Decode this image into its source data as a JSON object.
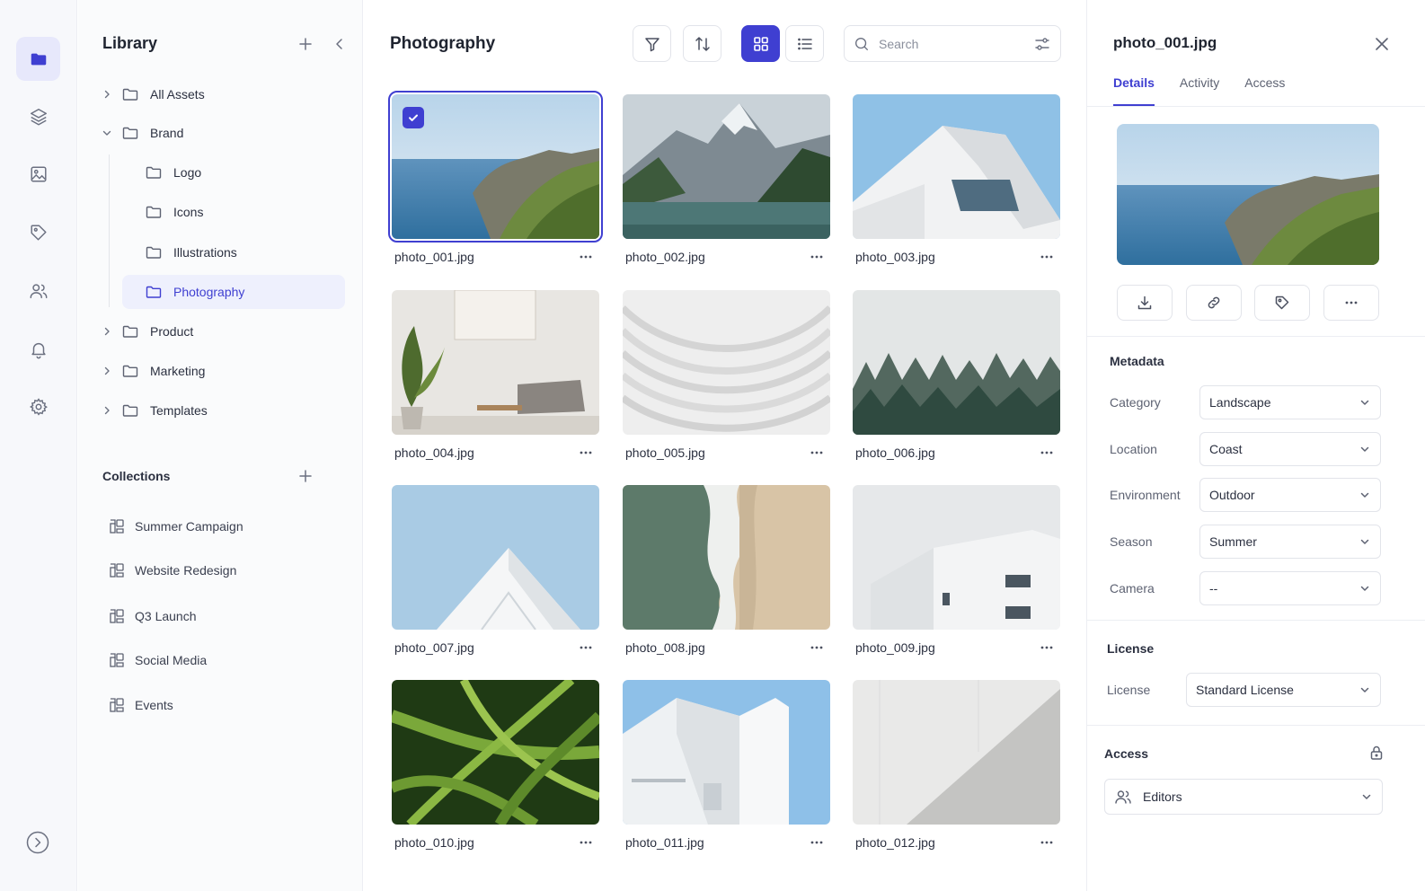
{
  "rail": {
    "items": [
      {
        "icon": "folder-icon",
        "active": true
      },
      {
        "icon": "layers-icon",
        "active": false
      },
      {
        "icon": "image-icon",
        "active": false
      },
      {
        "icon": "tag-icon",
        "active": false
      },
      {
        "icon": "users-icon",
        "active": false
      },
      {
        "icon": "bell-icon",
        "active": false
      },
      {
        "icon": "gear-icon",
        "active": false
      }
    ],
    "bottom_icon": "chevron-right-circle-icon"
  },
  "library": {
    "title": "Library",
    "tree": [
      {
        "label": "All Assets",
        "expanded": false
      },
      {
        "label": "Brand",
        "expanded": true
      },
      {
        "label": "Logo"
      },
      {
        "label": "Icons"
      },
      {
        "label": "Illustrations"
      },
      {
        "label": "Photography",
        "active": true
      },
      {
        "label": "Product",
        "expanded": false
      },
      {
        "label": "Marketing",
        "expanded": false
      },
      {
        "label": "Templates",
        "expanded": false
      }
    ],
    "collections_title": "Collections",
    "collections": [
      "Summer Campaign",
      "Website Redesign",
      "Q3 Launch",
      "Social Media",
      "Events"
    ]
  },
  "main": {
    "title": "Photography",
    "search_placeholder": "Search",
    "files": [
      {
        "name": "photo_001.jpg",
        "selected": true
      },
      {
        "name": "photo_002.jpg"
      },
      {
        "name": "photo_003.jpg"
      },
      {
        "name": "photo_004.jpg"
      },
      {
        "name": "photo_005.jpg"
      },
      {
        "name": "photo_006.jpg"
      },
      {
        "name": "photo_007.jpg"
      },
      {
        "name": "photo_008.jpg"
      },
      {
        "name": "photo_009.jpg"
      },
      {
        "name": "photo_010.jpg"
      },
      {
        "name": "photo_011.jpg"
      },
      {
        "name": "photo_012.jpg"
      }
    ]
  },
  "details": {
    "title": "photo_001.jpg",
    "tabs": [
      "Details",
      "Activity",
      "Access"
    ],
    "metadata_title": "Metadata",
    "metadata": [
      {
        "label": "Category",
        "value": "Landscape"
      },
      {
        "label": "Location",
        "value": "Coast"
      },
      {
        "label": "Environment",
        "value": "Outdoor"
      },
      {
        "label": "Season",
        "value": "Summer"
      },
      {
        "label": "Camera",
        "value": "--"
      }
    ],
    "license_title": "License",
    "license_label": "License",
    "license_value": "Standard License",
    "access_title": "Access",
    "access_value": "Editors"
  },
  "colors": {
    "accent": "#3f3fd1",
    "accent_soft": "#eef0fd"
  }
}
